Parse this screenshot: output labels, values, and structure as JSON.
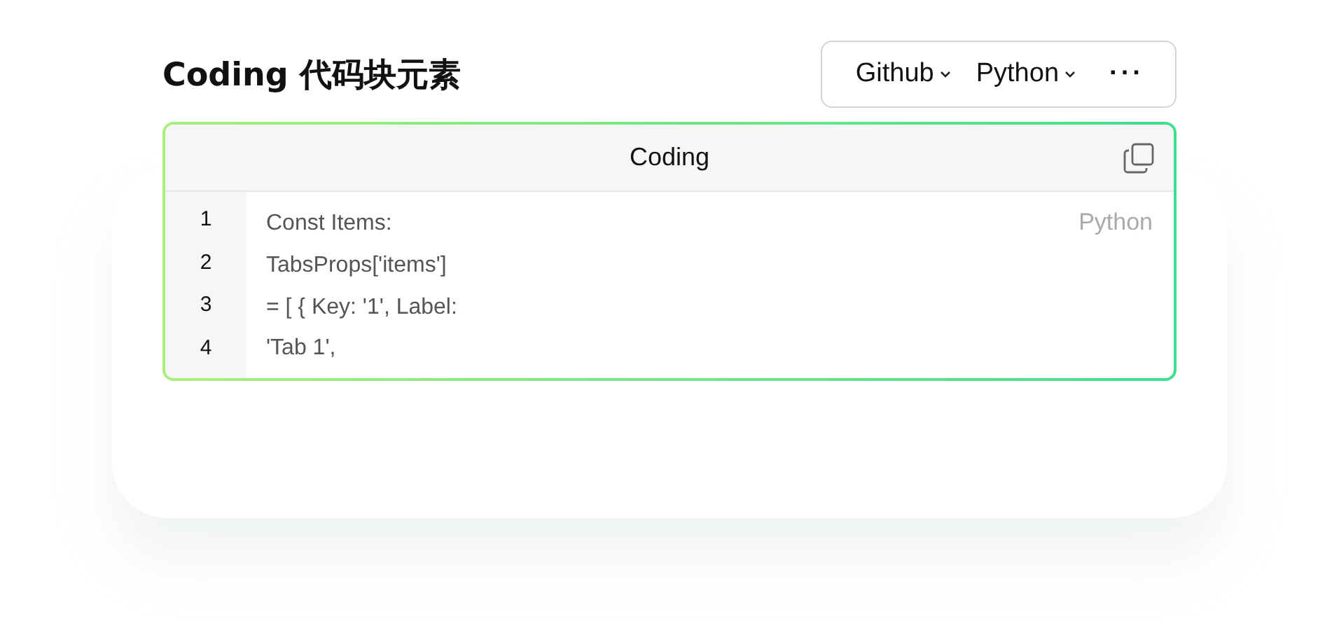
{
  "title": "Coding 代码块元素",
  "toolbar": [
    {
      "label": "Github",
      "kind": "dropdown"
    },
    {
      "label": "Python",
      "kind": "dropdown"
    },
    {
      "label": "···",
      "kind": "more"
    }
  ],
  "code_block": {
    "title": "Coding",
    "language": "Python",
    "lines": [
      {
        "number": "1",
        "text": "Const Items:"
      },
      {
        "number": "2",
        "text": "TabsProps['items']"
      },
      {
        "number": "3",
        "text": "= [ { Key: '1', Label:"
      },
      {
        "number": "4",
        "text": "'Tab 1',"
      }
    ]
  }
}
